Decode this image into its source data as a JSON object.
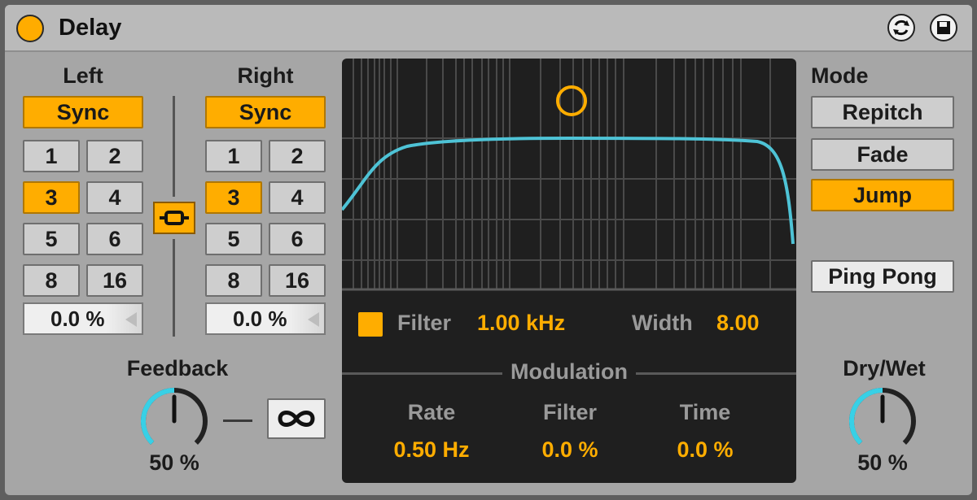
{
  "device": {
    "title": "Delay",
    "colors": {
      "accent": "#ffad00",
      "knob_arc": "#38d0e6",
      "filter_curve": "#4ec3d6"
    }
  },
  "header_icons": [
    "hot-swap-icon",
    "save-preset-icon"
  ],
  "left": {
    "label": "Left",
    "sync_label": "Sync",
    "sync_on": true,
    "divisions": [
      "1",
      "2",
      "3",
      "4",
      "5",
      "6",
      "8",
      "16"
    ],
    "selected_division": "3",
    "offset": "0.0 %"
  },
  "right": {
    "label": "Right",
    "sync_label": "Sync",
    "sync_on": true,
    "divisions": [
      "1",
      "2",
      "3",
      "4",
      "5",
      "6",
      "8",
      "16"
    ],
    "selected_division": "3",
    "offset": "0.0 %"
  },
  "link": {
    "icon": "link-icon",
    "on": true
  },
  "feedback": {
    "label": "Feedback",
    "value": "50 %",
    "level": 0.5,
    "freeze_icon": "infinity-icon"
  },
  "filter_display": {
    "filter_label": "Filter",
    "filter_value": "1.00 kHz",
    "width_label": "Width",
    "width_value": "8.00",
    "filter_on": true
  },
  "modulation": {
    "title": "Modulation",
    "rate_label": "Rate",
    "rate_value": "0.50 Hz",
    "filter_label": "Filter",
    "filter_value": "0.0 %",
    "time_label": "Time",
    "time_value": "0.0 %"
  },
  "mode": {
    "label": "Mode",
    "options": [
      "Repitch",
      "Fade",
      "Jump"
    ],
    "selected": "Jump",
    "ping_pong_label": "Ping Pong",
    "ping_pong_on": false
  },
  "dry_wet": {
    "label": "Dry/Wet",
    "value": "50 %",
    "level": 0.5
  }
}
